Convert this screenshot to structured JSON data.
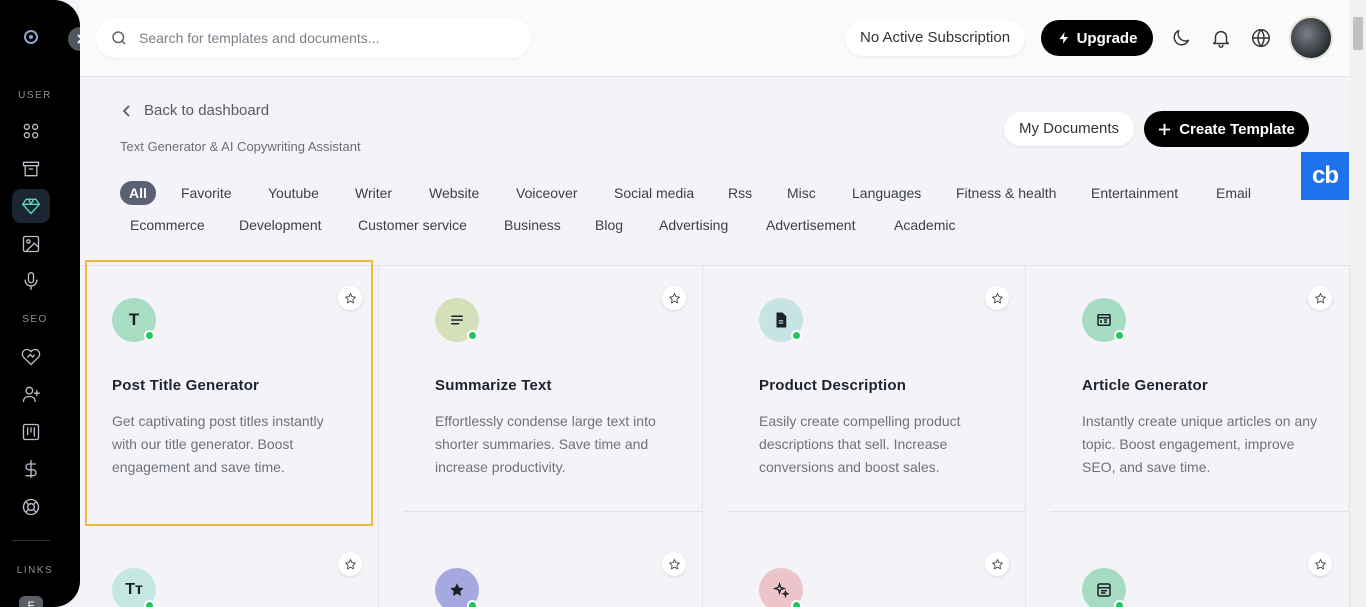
{
  "sidebar": {
    "user_label": "USER",
    "seo_label": "SEO",
    "links_label": "LINKS",
    "link_badge": "F",
    "items": [
      {
        "name": "dashboard",
        "icon": "grid-icon"
      },
      {
        "name": "archive",
        "icon": "archive-icon"
      },
      {
        "name": "templates",
        "icon": "diamond-icon",
        "active": true
      },
      {
        "name": "images",
        "icon": "image-icon"
      },
      {
        "name": "voice",
        "icon": "microphone-icon"
      },
      {
        "name": "seo",
        "icon": "handshake-icon"
      },
      {
        "name": "add-user",
        "icon": "user-plus-icon"
      },
      {
        "name": "board",
        "icon": "kanban-icon"
      },
      {
        "name": "pricing",
        "icon": "dollar-icon"
      },
      {
        "name": "support",
        "icon": "lifebuoy-icon"
      }
    ]
  },
  "topbar": {
    "search_placeholder": "Search for templates and documents...",
    "subscription_status": "No Active Subscription",
    "upgrade_label": "Upgrade"
  },
  "header": {
    "back_label": "Back to dashboard",
    "subtitle": "Text Generator & AI Copywriting Assistant",
    "my_documents_label": "My Documents",
    "create_template_label": "Create Template",
    "cb_badge": "cb"
  },
  "filters": {
    "row1": [
      "All",
      "Favorite",
      "Youtube",
      "Writer",
      "Website",
      "Voiceover",
      "Social media",
      "Rss",
      "Misc",
      "Languages",
      "Fitness & health",
      "Entertainment",
      "Email"
    ],
    "row2": [
      "Ecommerce",
      "Development",
      "Customer service",
      "Business",
      "Blog",
      "Advertising",
      "Advertisement",
      "Academic"
    ],
    "active": "All"
  },
  "cards": [
    {
      "title": "Post Title Generator",
      "description": "Get captivating post titles instantly with our title generator. Boost engagement and save time.",
      "icon": "text-T-icon",
      "icon_text": "T",
      "icon_color": "#a8dcc3"
    },
    {
      "title": "Summarize Text",
      "description": "Effortlessly condense large text into shorter summaries. Save time and increase productivity.",
      "icon": "lines-icon",
      "icon_color": "#d6e0b8"
    },
    {
      "title": "Product Description",
      "description": "Easily create compelling product descriptions that sell. Increase conversions and boost sales.",
      "icon": "document-icon",
      "icon_color": "#c6e4e4"
    },
    {
      "title": "Article Generator",
      "description": "Instantly create unique articles on any topic. Boost engagement, improve SEO, and save time.",
      "icon": "newspaper-icon",
      "icon_color": "#a6dcc4"
    },
    {
      "title": "",
      "description": "",
      "icon": "text-size-icon",
      "icon_text": "Tт",
      "icon_color": "#c4e8e0"
    },
    {
      "title": "",
      "description": "",
      "icon": "star-filled-icon",
      "icon_color": "#a6a8e0"
    },
    {
      "title": "",
      "description": "",
      "icon": "sparkles-icon",
      "icon_color": "#ecc4ca"
    },
    {
      "title": "",
      "description": "",
      "icon": "browser-icon",
      "icon_color": "#a6dcc4"
    }
  ],
  "colors": {
    "accent_black": "#000000",
    "online_dot": "#22c55e",
    "highlight": "#f4b740",
    "cb_blue": "#1e73ec"
  }
}
